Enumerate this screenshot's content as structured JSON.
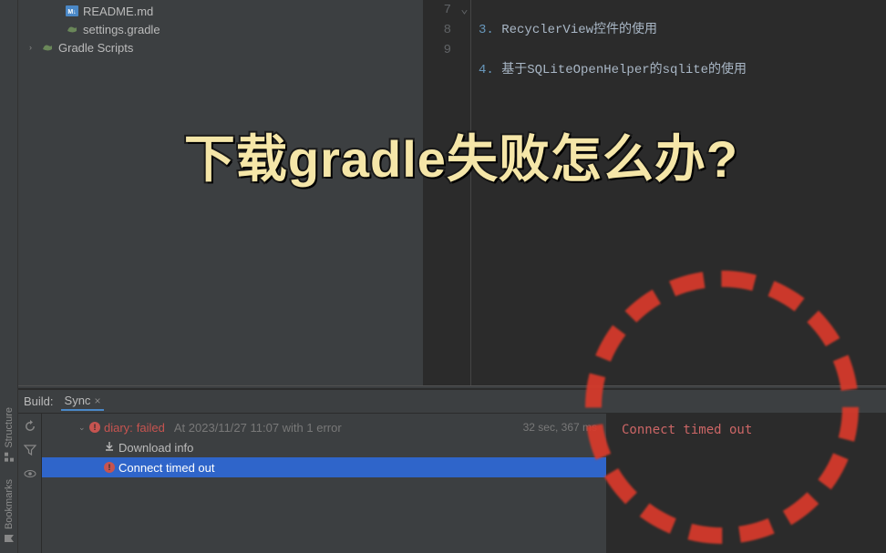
{
  "project_tree": {
    "items": [
      {
        "name": "README.md",
        "icon": "md",
        "indent": "indent-3"
      },
      {
        "name": "settings.gradle",
        "icon": "gradle",
        "indent": "indent-3"
      },
      {
        "name": "Gradle Scripts",
        "icon": "gradle",
        "indent": "indent-1",
        "expandable": true
      }
    ]
  },
  "editor": {
    "lines": [
      {
        "num": "7",
        "fold": "",
        "listnum": "3.",
        "text": "RecyclerView控件的使用"
      },
      {
        "num": "8",
        "fold": "",
        "listnum": "4.",
        "text": "基于SQLiteOpenHelper的sqlite的使用"
      },
      {
        "num": "9",
        "fold": "⌄",
        "listnum": "",
        "text": ""
      }
    ]
  },
  "build": {
    "title": "Build:",
    "tab": "Sync",
    "root_name": "diary:",
    "root_status": "failed",
    "root_meta": "At 2023/11/27 11:07 with 1 error",
    "root_time": "32 sec, 367 ms",
    "child1": "Download info",
    "child2": "Connect timed out",
    "detail": "Connect timed out"
  },
  "left_gutter": {
    "structure": "Structure",
    "bookmarks": "Bookmarks"
  },
  "overlay": {
    "title": "下载gradle失败怎么办?"
  }
}
